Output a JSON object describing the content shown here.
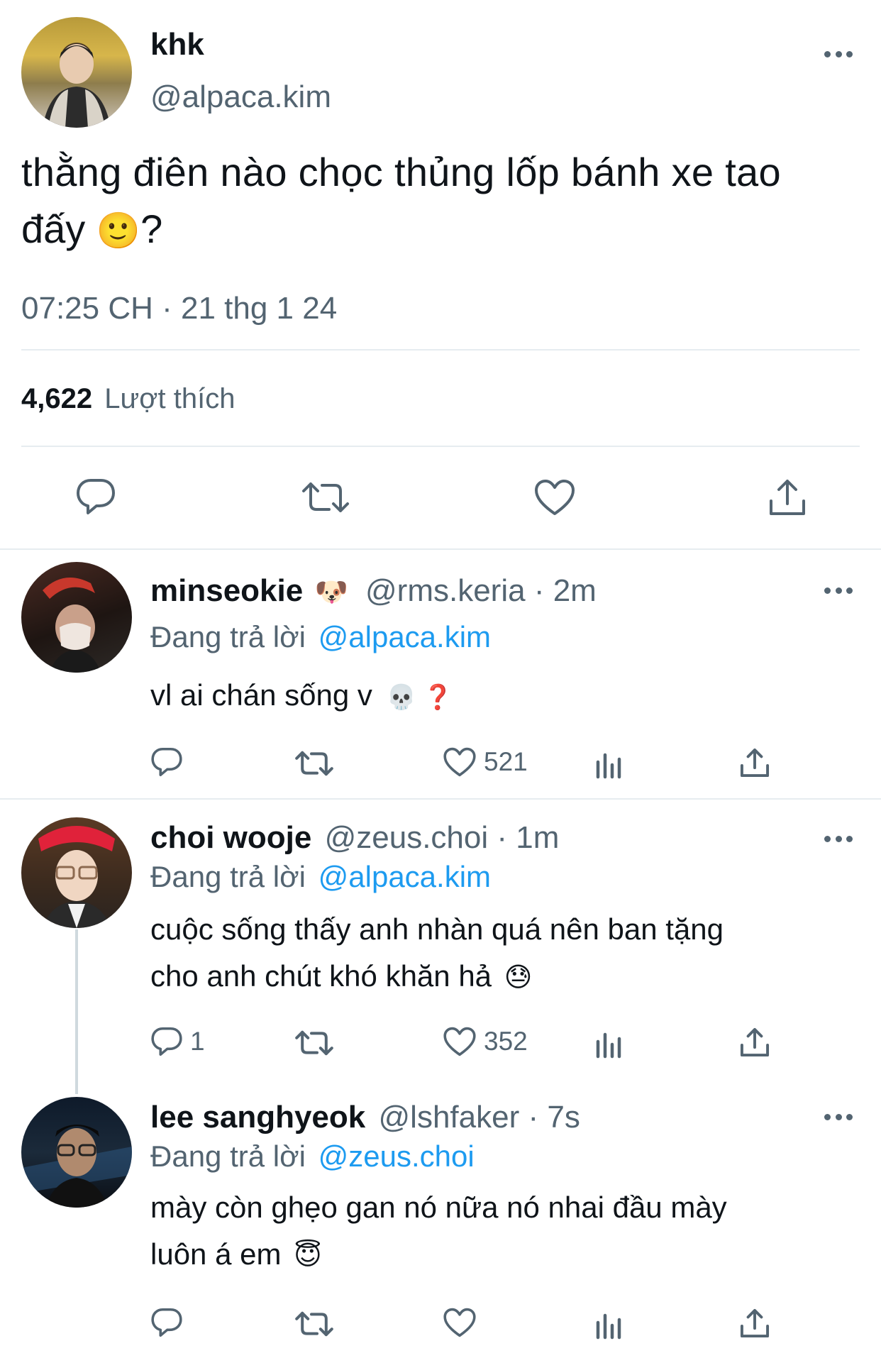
{
  "main_tweet": {
    "display_name": "khk",
    "handle": "@alpaca.kim",
    "text_line1": "thằng điên nào chọc thủng lốp bánh xe tao",
    "text_line2": "đấy",
    "text_emoji": "🙂",
    "text_suffix": "?",
    "timestamp": "07:25 CH · 21 thg 1 24",
    "likes_count": "4,622",
    "likes_label": "Lượt thích"
  },
  "replies": [
    {
      "display_name": "minseokie",
      "name_emoji": "🐶",
      "handle": "@rms.keria",
      "time": "· 2m",
      "replying_label": "Đang trả lời",
      "replying_to": "@alpaca.kim",
      "text_line1": "vl ai chán sống v",
      "text_emoji": "💀 ❓",
      "reply_count": "",
      "like_count": "521"
    },
    {
      "display_name": "choi wooje",
      "handle": "@zeus.choi",
      "time": "· 1m",
      "replying_label": "Đang trả lời",
      "replying_to": "@alpaca.kim",
      "text_line1": "cuộc sống thấy anh nhàn quá nên ban tặng",
      "text_line2": "cho anh chút khó khăn hả",
      "text_emoji": "😓",
      "reply_count": "1",
      "like_count": "352"
    },
    {
      "display_name": "lee sanghyeok",
      "handle": "@lshfaker",
      "time": "· 7s",
      "replying_label": "Đang trả lời",
      "replying_to": "@zeus.choi",
      "text_line1": "mày còn ghẹo gan nó nữa nó nhai đầu mày",
      "text_line2": "luôn á em",
      "text_emoji": "😇",
      "reply_count": "",
      "like_count": ""
    }
  ],
  "colors": {
    "link": "#1d9bf0",
    "muted": "#536471",
    "divider": "#e6ecf0"
  }
}
